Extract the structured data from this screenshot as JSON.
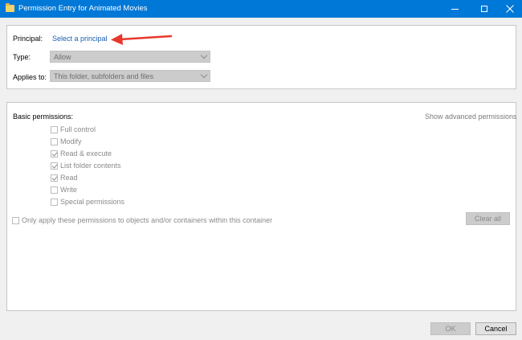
{
  "window": {
    "title": "Permission Entry for Animated Movies",
    "icons": {
      "folder": "folder-icon",
      "minimize": "minimize-icon",
      "maximize": "maximize-icon",
      "close": "close-icon"
    },
    "accent_color": "#0078d7"
  },
  "principal": {
    "label": "Principal:",
    "link": "Select a principal",
    "annotation_arrow_color": "#e8382b"
  },
  "type": {
    "label": "Type:",
    "value": "Allow"
  },
  "applies_to": {
    "label": "Applies to:",
    "value": "This folder, subfolders and files"
  },
  "permissions": {
    "heading": "Basic permissions:",
    "advanced_link": "Show advanced permissions",
    "items": [
      {
        "label": "Full control",
        "checked": false
      },
      {
        "label": "Modify",
        "checked": false
      },
      {
        "label": "Read & execute",
        "checked": true
      },
      {
        "label": "List folder contents",
        "checked": true
      },
      {
        "label": "Read",
        "checked": true
      },
      {
        "label": "Write",
        "checked": false
      },
      {
        "label": "Special permissions",
        "checked": false
      }
    ],
    "only_apply_label": "Only apply these permissions to objects and/or containers within this container",
    "clear_all": "Clear all"
  },
  "footer": {
    "ok": "OK",
    "cancel": "Cancel"
  }
}
